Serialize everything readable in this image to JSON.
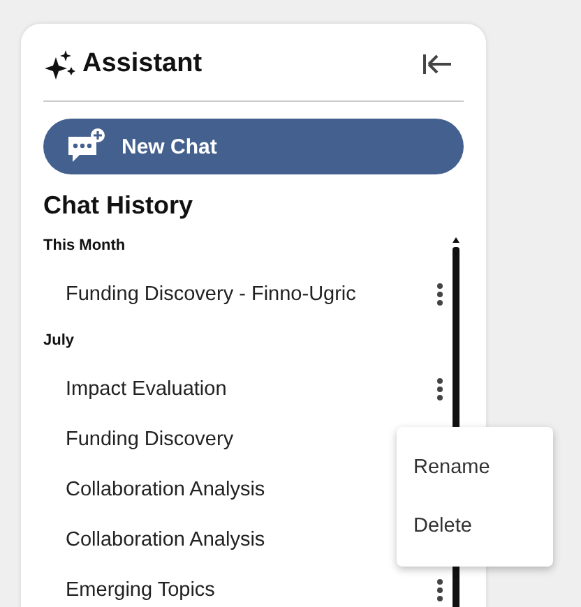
{
  "panel": {
    "title": "Assistant",
    "new_chat_label": "New Chat"
  },
  "history": {
    "heading": "Chat History",
    "groups": [
      {
        "label": "This Month",
        "items": [
          {
            "title": "Funding Discovery - Finno-Ugric",
            "actions_visible": true
          }
        ]
      },
      {
        "label": "July",
        "items": [
          {
            "title": "Impact Evaluation",
            "actions_visible": true
          },
          {
            "title": "Funding Discovery"
          },
          {
            "title": "Collaboration Analysis"
          },
          {
            "title": "Collaboration Analysis"
          },
          {
            "title": "Emerging Topics",
            "actions_visible": true
          }
        ]
      }
    ]
  },
  "context_menu": {
    "items": [
      "Rename",
      "Delete"
    ]
  }
}
